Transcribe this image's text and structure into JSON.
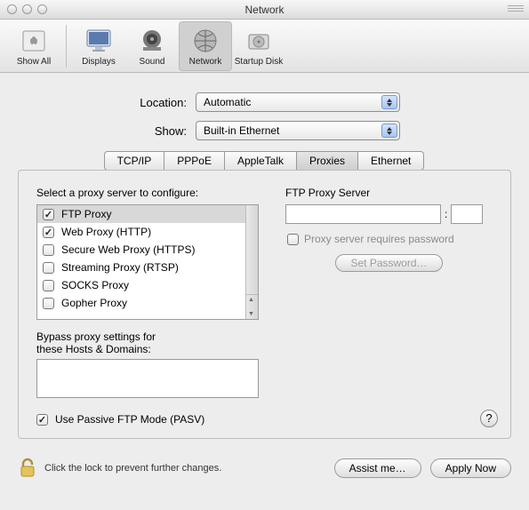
{
  "window": {
    "title": "Network"
  },
  "toolbar": {
    "items": [
      {
        "id": "show-all",
        "label": "Show All"
      },
      {
        "id": "displays",
        "label": "Displays"
      },
      {
        "id": "sound",
        "label": "Sound"
      },
      {
        "id": "network",
        "label": "Network"
      },
      {
        "id": "startup-disk",
        "label": "Startup Disk"
      }
    ],
    "selected": "network"
  },
  "selectors": {
    "location_label": "Location:",
    "location_value": "Automatic",
    "show_label": "Show:",
    "show_value": "Built-in Ethernet"
  },
  "tabs": {
    "items": [
      "TCP/IP",
      "PPPoE",
      "AppleTalk",
      "Proxies",
      "Ethernet"
    ],
    "active": "Proxies"
  },
  "proxies": {
    "list_heading": "Select a proxy server to configure:",
    "list": [
      {
        "label": "FTP Proxy",
        "checked": true,
        "selected": true
      },
      {
        "label": "Web Proxy (HTTP)",
        "checked": true,
        "selected": false
      },
      {
        "label": "Secure Web Proxy (HTTPS)",
        "checked": false,
        "selected": false
      },
      {
        "label": "Streaming Proxy (RTSP)",
        "checked": false,
        "selected": false
      },
      {
        "label": "SOCKS Proxy",
        "checked": false,
        "selected": false
      },
      {
        "label": "Gopher Proxy",
        "checked": false,
        "selected": false
      }
    ],
    "server_heading": "FTP Proxy Server",
    "server_host": "",
    "server_port": "",
    "port_separator": ":",
    "requires_password_label": "Proxy server requires password",
    "requires_password_checked": false,
    "set_password_label": "Set Password…",
    "bypass_label_1": "Bypass proxy settings for",
    "bypass_label_2": "these Hosts & Domains:",
    "bypass_value": "",
    "pasv_label": "Use Passive FTP Mode (PASV)",
    "pasv_checked": true,
    "help_label": "?"
  },
  "footer": {
    "lock_text": "Click the lock to prevent further changes.",
    "assist_label": "Assist me…",
    "apply_label": "Apply Now"
  }
}
